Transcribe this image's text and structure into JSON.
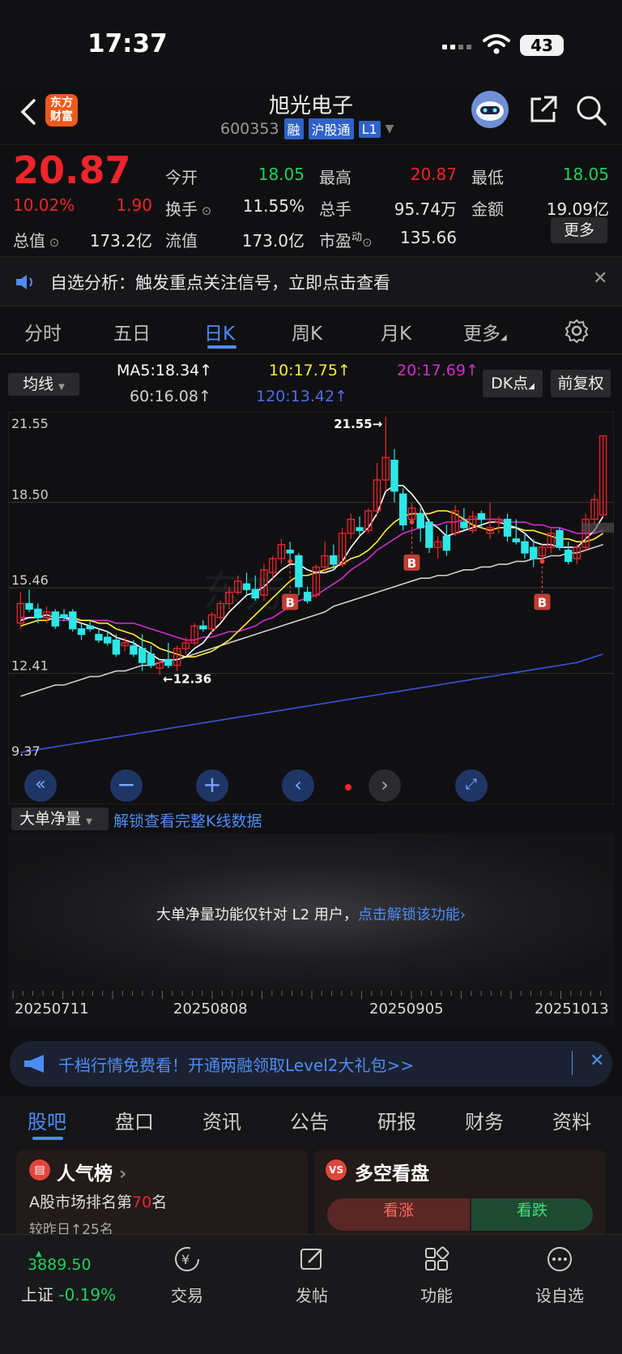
{
  "status_bar": {
    "time": "17:37",
    "battery": "43"
  },
  "header": {
    "stock_name": "旭光电子",
    "stock_code": "600353",
    "tags": [
      "融",
      "沪股通",
      "L1"
    ],
    "logo_text_line1": "东方",
    "logo_text_line2": "财富"
  },
  "quote": {
    "price": "20.87",
    "change_pct": "10.02%",
    "change_amt": "1.90",
    "stats": [
      {
        "label": "今开",
        "value": "18.05",
        "color": "green"
      },
      {
        "label": "最高",
        "value": "20.87",
        "color": "red"
      },
      {
        "label": "最低",
        "value": "18.05",
        "color": "green"
      },
      {
        "label": "换手",
        "value": "11.55%",
        "color": "white"
      },
      {
        "label": "总手",
        "value": "95.74万",
        "color": "white"
      },
      {
        "label": "金额",
        "value": "19.09亿",
        "color": "white"
      },
      {
        "label": "总值",
        "value": "173.2亿",
        "color": "white"
      },
      {
        "label": "流值",
        "value": "173.0亿",
        "color": "white"
      },
      {
        "label": "市盈",
        "value": "135.66",
        "color": "white"
      }
    ],
    "pe_superscript": "动",
    "more_label": "更多"
  },
  "notice": {
    "text": "自选分析：触发重点关注信号，立即点击查看"
  },
  "k_tabs": [
    "分时",
    "五日",
    "日K",
    "周K",
    "月K",
    "更多"
  ],
  "active_k_tab": "日K",
  "ma_row": {
    "indicator_select": "均线",
    "ma5": "MA5:18.34",
    "ma10": "10:17.75",
    "ma20": "20:17.69",
    "ma60": "60:16.08",
    "ma120": "120:13.42",
    "dk_label": "DK点",
    "adjust_label": "前复权"
  },
  "colors": {
    "up": "#f0242a",
    "down": "#1fd15b",
    "candle_down": "#2ee6e6",
    "ma5": "#ffffff",
    "ma10": "#ffee33",
    "ma20": "#d02ed0",
    "ma60": "#cfcfcf",
    "ma120": "#3b54d9",
    "accent": "#4d8cf5"
  },
  "chart_data": {
    "type": "candlestick",
    "y_axis_labels": [
      "21.55",
      "18.50",
      "15.46",
      "12.41",
      "9.37"
    ],
    "ylim": [
      9.37,
      21.55
    ],
    "dates_shown": [
      "20250711",
      "20250808",
      "20250905",
      "20251013"
    ],
    "high_marker": "21.55→",
    "low_marker": "←12.36",
    "buy_signal_label": "B",
    "candles": [
      {
        "o": 14.2,
        "h": 15.3,
        "l": 14.0,
        "c": 14.9
      },
      {
        "o": 14.9,
        "h": 15.4,
        "l": 14.6,
        "c": 14.7
      },
      {
        "o": 14.7,
        "h": 14.9,
        "l": 14.2,
        "c": 14.4
      },
      {
        "o": 14.4,
        "h": 14.8,
        "l": 14.2,
        "c": 14.6
      },
      {
        "o": 14.6,
        "h": 14.7,
        "l": 14.0,
        "c": 14.1
      },
      {
        "o": 14.5,
        "h": 14.7,
        "l": 14.3,
        "c": 14.4
      },
      {
        "o": 14.6,
        "h": 14.7,
        "l": 13.9,
        "c": 14.0
      },
      {
        "o": 14.0,
        "h": 14.2,
        "l": 13.6,
        "c": 13.8
      },
      {
        "o": 14.1,
        "h": 14.3,
        "l": 13.9,
        "c": 14.0
      },
      {
        "o": 13.8,
        "h": 14.0,
        "l": 13.5,
        "c": 13.6
      },
      {
        "o": 13.7,
        "h": 13.9,
        "l": 13.4,
        "c": 13.5
      },
      {
        "o": 13.6,
        "h": 13.8,
        "l": 13.0,
        "c": 13.1
      },
      {
        "o": 13.4,
        "h": 13.7,
        "l": 13.2,
        "c": 13.5
      },
      {
        "o": 13.4,
        "h": 13.6,
        "l": 13.0,
        "c": 13.1
      },
      {
        "o": 13.3,
        "h": 13.8,
        "l": 12.5,
        "c": 12.8
      },
      {
        "o": 13.1,
        "h": 13.4,
        "l": 12.6,
        "c": 12.7
      },
      {
        "o": 12.6,
        "h": 12.9,
        "l": 12.36,
        "c": 12.8
      },
      {
        "o": 12.9,
        "h": 13.5,
        "l": 12.6,
        "c": 12.7
      },
      {
        "o": 12.7,
        "h": 13.4,
        "l": 12.5,
        "c": 13.3
      },
      {
        "o": 13.3,
        "h": 13.7,
        "l": 13.1,
        "c": 13.5
      },
      {
        "o": 13.5,
        "h": 14.2,
        "l": 13.4,
        "c": 14.1
      },
      {
        "o": 14.1,
        "h": 14.3,
        "l": 13.9,
        "c": 14.0
      },
      {
        "o": 14.0,
        "h": 14.6,
        "l": 13.8,
        "c": 14.5
      },
      {
        "o": 14.4,
        "h": 15.0,
        "l": 14.3,
        "c": 14.9
      },
      {
        "o": 14.9,
        "h": 15.5,
        "l": 14.7,
        "c": 15.3
      },
      {
        "o": 15.3,
        "h": 15.9,
        "l": 15.2,
        "c": 15.7
      },
      {
        "o": 15.6,
        "h": 16.0,
        "l": 15.2,
        "c": 15.4
      },
      {
        "o": 15.4,
        "h": 15.9,
        "l": 15.0,
        "c": 15.1
      },
      {
        "o": 15.2,
        "h": 16.3,
        "l": 15.0,
        "c": 16.1
      },
      {
        "o": 16.0,
        "h": 16.6,
        "l": 15.8,
        "c": 16.5
      },
      {
        "o": 16.5,
        "h": 17.2,
        "l": 16.3,
        "c": 17.0
      },
      {
        "o": 16.8,
        "h": 17.1,
        "l": 16.4,
        "c": 16.7
      },
      {
        "o": 16.6,
        "h": 16.7,
        "l": 15.2,
        "c": 15.5
      },
      {
        "o": 15.3,
        "h": 15.5,
        "l": 14.9,
        "c": 15.0
      },
      {
        "o": 15.2,
        "h": 16.3,
        "l": 15.1,
        "c": 16.2
      },
      {
        "o": 16.2,
        "h": 17.1,
        "l": 16.0,
        "c": 16.6
      },
      {
        "o": 16.6,
        "h": 17.0,
        "l": 16.1,
        "c": 16.3
      },
      {
        "o": 16.3,
        "h": 17.6,
        "l": 16.2,
        "c": 17.4
      },
      {
        "o": 17.4,
        "h": 18.1,
        "l": 17.2,
        "c": 17.9
      },
      {
        "o": 17.6,
        "h": 18.0,
        "l": 17.3,
        "c": 17.5
      },
      {
        "o": 17.5,
        "h": 18.3,
        "l": 17.4,
        "c": 18.2
      },
      {
        "o": 18.2,
        "h": 19.9,
        "l": 18.0,
        "c": 19.3
      },
      {
        "o": 19.3,
        "h": 21.55,
        "l": 18.9,
        "c": 20.1
      },
      {
        "o": 20.0,
        "h": 20.4,
        "l": 18.5,
        "c": 18.9
      },
      {
        "o": 18.8,
        "h": 19.0,
        "l": 17.5,
        "c": 17.7
      },
      {
        "o": 17.9,
        "h": 18.5,
        "l": 17.8,
        "c": 18.3
      },
      {
        "o": 18.1,
        "h": 18.3,
        "l": 17.1,
        "c": 17.6
      },
      {
        "o": 17.8,
        "h": 17.9,
        "l": 16.7,
        "c": 16.9
      },
      {
        "o": 16.9,
        "h": 17.3,
        "l": 16.5,
        "c": 17.1
      },
      {
        "o": 17.3,
        "h": 17.7,
        "l": 16.6,
        "c": 16.8
      },
      {
        "o": 17.4,
        "h": 18.4,
        "l": 17.3,
        "c": 18.2
      },
      {
        "o": 17.8,
        "h": 18.3,
        "l": 17.5,
        "c": 17.6
      },
      {
        "o": 17.5,
        "h": 18.2,
        "l": 17.4,
        "c": 18.0
      },
      {
        "o": 18.1,
        "h": 18.2,
        "l": 17.6,
        "c": 17.9
      },
      {
        "o": 17.4,
        "h": 18.5,
        "l": 17.2,
        "c": 17.6
      },
      {
        "o": 17.8,
        "h": 18.0,
        "l": 17.4,
        "c": 17.9
      },
      {
        "o": 17.9,
        "h": 18.1,
        "l": 17.1,
        "c": 17.3
      },
      {
        "o": 17.2,
        "h": 17.9,
        "l": 17.0,
        "c": 17.1
      },
      {
        "o": 17.1,
        "h": 17.4,
        "l": 16.5,
        "c": 16.7
      },
      {
        "o": 16.9,
        "h": 17.2,
        "l": 16.2,
        "c": 16.5
      },
      {
        "o": 16.6,
        "h": 17.0,
        "l": 16.4,
        "c": 16.9
      },
      {
        "o": 16.9,
        "h": 17.6,
        "l": 16.7,
        "c": 17.4
      },
      {
        "o": 17.5,
        "h": 17.6,
        "l": 16.8,
        "c": 16.9
      },
      {
        "o": 16.8,
        "h": 17.1,
        "l": 16.3,
        "c": 16.4
      },
      {
        "o": 16.5,
        "h": 17.0,
        "l": 16.3,
        "c": 16.9
      },
      {
        "o": 16.9,
        "h": 18.1,
        "l": 16.8,
        "c": 17.9
      },
      {
        "o": 17.9,
        "h": 18.8,
        "l": 17.7,
        "c": 18.6
      },
      {
        "o": 18.05,
        "h": 20.87,
        "l": 18.05,
        "c": 20.87
      }
    ],
    "ma5": [
      14.3,
      14.4,
      14.4,
      14.5,
      14.4,
      14.4,
      14.3,
      14.2,
      14.1,
      14.0,
      13.9,
      13.7,
      13.6,
      13.5,
      13.3,
      13.1,
      12.9,
      12.9,
      12.9,
      13.0,
      13.3,
      13.5,
      13.9,
      14.2,
      14.6,
      14.9,
      15.2,
      15.3,
      15.5,
      15.8,
      16.1,
      16.3,
      16.3,
      16.1,
      16.0,
      16.0,
      16.1,
      16.4,
      16.9,
      17.3,
      17.6,
      18.1,
      18.9,
      19.1,
      19.1,
      18.8,
      18.4,
      17.8,
      17.6,
      17.3,
      17.4,
      17.5,
      17.6,
      17.7,
      17.8,
      17.8,
      17.7,
      17.6,
      17.4,
      17.1,
      17.0,
      17.0,
      16.9,
      16.9,
      16.9,
      17.2,
      17.5,
      18.0
    ],
    "ma10": [
      14.1,
      14.2,
      14.3,
      14.3,
      14.4,
      14.4,
      14.4,
      14.3,
      14.3,
      14.2,
      14.2,
      14.0,
      13.9,
      13.8,
      13.6,
      13.5,
      13.3,
      13.2,
      13.1,
      13.0,
      13.0,
      13.1,
      13.2,
      13.4,
      13.6,
      13.9,
      14.2,
      14.5,
      14.8,
      15.1,
      15.4,
      15.7,
      15.9,
      15.9,
      16.0,
      16.1,
      16.2,
      16.3,
      16.5,
      16.6,
      16.8,
      17.1,
      17.5,
      17.8,
      18.0,
      18.1,
      18.1,
      18.1,
      18.2,
      18.2,
      18.1,
      17.9,
      17.7,
      17.6,
      17.5,
      17.6,
      17.6,
      17.6,
      17.5,
      17.5,
      17.4,
      17.3,
      17.2,
      17.2,
      17.1,
      17.1,
      17.2,
      17.4
    ],
    "ma20": [
      14.4,
      14.4,
      14.4,
      14.4,
      14.3,
      14.3,
      14.3,
      14.3,
      14.3,
      14.3,
      14.3,
      14.2,
      14.2,
      14.2,
      14.1,
      14.0,
      13.9,
      13.8,
      13.7,
      13.6,
      13.6,
      13.7,
      13.7,
      13.8,
      13.9,
      13.9,
      14.0,
      14.1,
      14.3,
      14.4,
      14.6,
      14.8,
      15.0,
      15.1,
      15.2,
      15.4,
      15.6,
      15.8,
      16.1,
      16.3,
      16.5,
      16.8,
      17.0,
      17.2,
      17.4,
      17.5,
      17.6,
      17.7,
      17.7,
      17.8,
      17.8,
      17.9,
      17.9,
      17.9,
      17.9,
      17.9,
      17.8,
      17.8,
      17.8,
      17.7,
      17.7,
      17.6,
      17.6,
      17.5,
      17.4,
      17.4,
      17.4,
      17.5
    ],
    "ma60": [
      11.6,
      11.7,
      11.8,
      11.9,
      12.0,
      12.0,
      12.1,
      12.2,
      12.3,
      12.3,
      12.4,
      12.5,
      12.5,
      12.6,
      12.7,
      12.7,
      12.8,
      12.9,
      12.9,
      13.0,
      13.1,
      13.2,
      13.3,
      13.4,
      13.5,
      13.6,
      13.7,
      13.8,
      13.9,
      14.0,
      14.1,
      14.2,
      14.3,
      14.4,
      14.5,
      14.6,
      14.8,
      14.9,
      15.0,
      15.1,
      15.2,
      15.3,
      15.4,
      15.5,
      15.6,
      15.7,
      15.8,
      15.8,
      15.9,
      15.9,
      16.0,
      16.1,
      16.1,
      16.2,
      16.2,
      16.3,
      16.3,
      16.4,
      16.4,
      16.5,
      16.5,
      16.6,
      16.6,
      16.7,
      16.7,
      16.8,
      16.9,
      17.0
    ],
    "ma120": [
      9.6,
      9.65,
      9.7,
      9.75,
      9.8,
      9.85,
      9.9,
      9.95,
      10.0,
      10.05,
      10.1,
      10.15,
      10.2,
      10.25,
      10.3,
      10.35,
      10.4,
      10.45,
      10.5,
      10.55,
      10.6,
      10.65,
      10.7,
      10.75,
      10.8,
      10.85,
      10.9,
      10.95,
      11.0,
      11.05,
      11.1,
      11.15,
      11.2,
      11.25,
      11.3,
      11.35,
      11.4,
      11.45,
      11.5,
      11.55,
      11.6,
      11.65,
      11.7,
      11.75,
      11.8,
      11.85,
      11.9,
      11.95,
      12.0,
      12.05,
      12.1,
      12.15,
      12.2,
      12.25,
      12.3,
      12.35,
      12.4,
      12.45,
      12.5,
      12.55,
      12.6,
      12.65,
      12.7,
      12.75,
      12.8,
      12.9,
      13.0,
      13.1
    ],
    "buy_signal_indices": [
      31,
      45,
      60
    ]
  },
  "sub_panel": {
    "indicator": "大单净量",
    "unlock_link": "解锁查看完整K线数据",
    "locked_text": "大单净量功能仅针对 L2 用户，",
    "locked_link": "点击解锁该功能›"
  },
  "promo": {
    "text": "千档行情免费看！开通两融领取Level2大礼包>>"
  },
  "community_tabs": [
    "股吧",
    "盘口",
    "资讯",
    "公告",
    "研报",
    "财务",
    "资料"
  ],
  "active_community_tab": "股吧",
  "cards": {
    "popularity_title": "人气榜",
    "popularity_rank_prefix": "A股市场排名第",
    "popularity_rank": "70",
    "popularity_rank_suffix": "名",
    "popularity_sub": "较昨日↑25名",
    "vote_title": "多空看盘",
    "bull_label": "看涨",
    "bear_label": "看跌"
  },
  "bottom_nav": {
    "index_value": "3889.50",
    "index_name": "上证",
    "index_change": "-0.19%",
    "items": [
      "交易",
      "发帖",
      "功能",
      "设自选"
    ]
  }
}
